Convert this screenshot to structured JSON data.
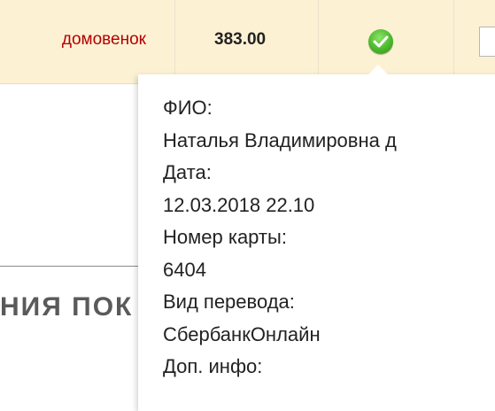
{
  "row": {
    "name": "домовенок",
    "amount": "383.00"
  },
  "section": {
    "title_fragment": "НИЯ ПОК"
  },
  "popup": {
    "fio_label": "ФИО:",
    "fio_value": "Наталья Владимировна д",
    "date_label": "Дата:",
    "date_value": "12.03.2018 22.10",
    "card_label": "Номер карты:",
    "card_value": "6404",
    "transfer_label": "Вид перевода:",
    "transfer_value": "СбербанкОнлайн",
    "extra_label": "Доп. инфо:"
  },
  "colors": {
    "row_background": "#fdf1d4",
    "link": "#b30000",
    "status_ok": "#4bb82b"
  },
  "icons": {
    "status": "check-circle-icon"
  }
}
